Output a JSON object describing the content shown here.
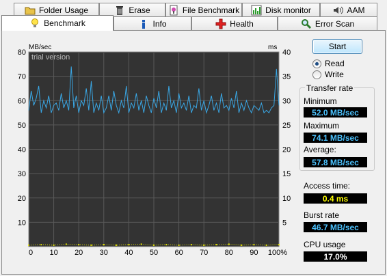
{
  "tabs_top": [
    {
      "label": "Folder Usage",
      "icon": "folder-icon"
    },
    {
      "label": "Erase",
      "icon": "trash-icon"
    },
    {
      "label": "File Benchmark",
      "icon": "file-benchmark-icon"
    },
    {
      "label": "Disk monitor",
      "icon": "disk-monitor-icon"
    },
    {
      "label": "AAM",
      "icon": "speaker-icon"
    }
  ],
  "tabs_bottom": [
    {
      "label": "Benchmark",
      "icon": "lightbulb-icon",
      "active": true
    },
    {
      "label": "Info",
      "icon": "info-icon"
    },
    {
      "label": "Health",
      "icon": "health-cross-icon"
    },
    {
      "label": "Error Scan",
      "icon": "magnifier-icon"
    }
  ],
  "controls": {
    "start_label": "Start",
    "read_label": "Read",
    "write_label": "Write",
    "selected_mode": "Read"
  },
  "stats": {
    "transfer_rate_title": "Transfer rate",
    "minimum_label": "Minimum",
    "minimum_value": "52.0 MB/sec",
    "maximum_label": "Maximum",
    "maximum_value": "74.1 MB/sec",
    "average_label": "Average:",
    "average_value": "57.8 MB/sec",
    "access_time_label": "Access time:",
    "access_time_value": "0.4 ms",
    "burst_rate_label": "Burst rate",
    "burst_rate_value": "46.7 MB/sec",
    "cpu_usage_label": "CPU usage",
    "cpu_usage_value": "17.0%"
  },
  "chart_data": {
    "type": "line",
    "watermark": "trial version",
    "left_axis_unit": "MB/sec",
    "right_axis_unit": "ms",
    "left_ticks": [
      "80",
      "70",
      "60",
      "50",
      "40",
      "30",
      "20",
      "10",
      "0"
    ],
    "right_ticks": [
      "40",
      "35",
      "30",
      "25",
      "20",
      "15",
      "10",
      "5"
    ],
    "x_ticks": [
      "0",
      "10",
      "20",
      "30",
      "40",
      "50",
      "60",
      "70",
      "80",
      "90",
      "100%"
    ],
    "ylim": [
      0,
      80
    ],
    "y2lim": [
      0,
      40
    ],
    "xlim": [
      0,
      100
    ],
    "colors": {
      "transfer": "#3aa8e6",
      "access": "#e8e800",
      "background": "#333333",
      "grid": "#5a5a5a"
    },
    "series": [
      {
        "kind": "transfer",
        "x": [
          0,
          1,
          2,
          3,
          4,
          5,
          6,
          7,
          8,
          9,
          10,
          11,
          12,
          13,
          14,
          15,
          16,
          17,
          18,
          19,
          20,
          21,
          22,
          23,
          24,
          25,
          26,
          27,
          28,
          29,
          30,
          31,
          32,
          33,
          34,
          35,
          36,
          37,
          38,
          39,
          40,
          41,
          42,
          43,
          44,
          45,
          46,
          47,
          48,
          49,
          50,
          51,
          52,
          53,
          54,
          55,
          56,
          57,
          58,
          59,
          60,
          61,
          62,
          63,
          64,
          65,
          66,
          67,
          68,
          69,
          70,
          71,
          72,
          73,
          74,
          75,
          76,
          77,
          78,
          79,
          80,
          81,
          82,
          83,
          84,
          85,
          86,
          87,
          88,
          89,
          90,
          91,
          92,
          93,
          94,
          95,
          96,
          97,
          98,
          99,
          100
        ],
        "values": [
          56,
          64,
          58,
          61,
          66,
          55,
          60,
          57,
          62,
          55,
          58,
          59,
          56,
          63,
          57,
          60,
          56,
          74,
          57,
          62,
          55,
          60,
          58,
          65,
          56,
          68,
          55,
          59,
          56,
          62,
          55,
          57,
          62,
          56,
          64,
          58,
          55,
          60,
          57,
          66,
          55,
          59,
          57,
          63,
          56,
          60,
          55,
          62,
          58,
          55,
          61,
          57,
          64,
          55,
          59,
          56,
          66,
          57,
          60,
          55,
          63,
          57,
          59,
          56,
          62,
          55,
          58,
          57,
          65,
          56,
          60,
          55,
          58,
          62,
          56,
          59,
          55,
          63,
          57,
          58,
          56,
          61,
          57,
          64,
          55,
          59,
          56,
          60,
          57,
          55,
          58,
          57,
          56,
          59,
          55,
          56,
          55,
          57,
          58,
          73,
          58
        ]
      },
      {
        "kind": "access",
        "x": [
          0,
          5,
          10,
          15,
          20,
          25,
          30,
          35,
          40,
          45,
          50,
          55,
          60,
          65,
          70,
          75,
          80,
          85,
          90,
          95,
          100
        ],
        "values": [
          0.3,
          0.4,
          0.3,
          0.5,
          0.4,
          0.3,
          0.4,
          0.3,
          0.4,
          0.5,
          0.3,
          0.4,
          0.3,
          0.4,
          0.3,
          0.4,
          0.5,
          0.3,
          0.4,
          0.3,
          0.4
        ]
      }
    ]
  }
}
